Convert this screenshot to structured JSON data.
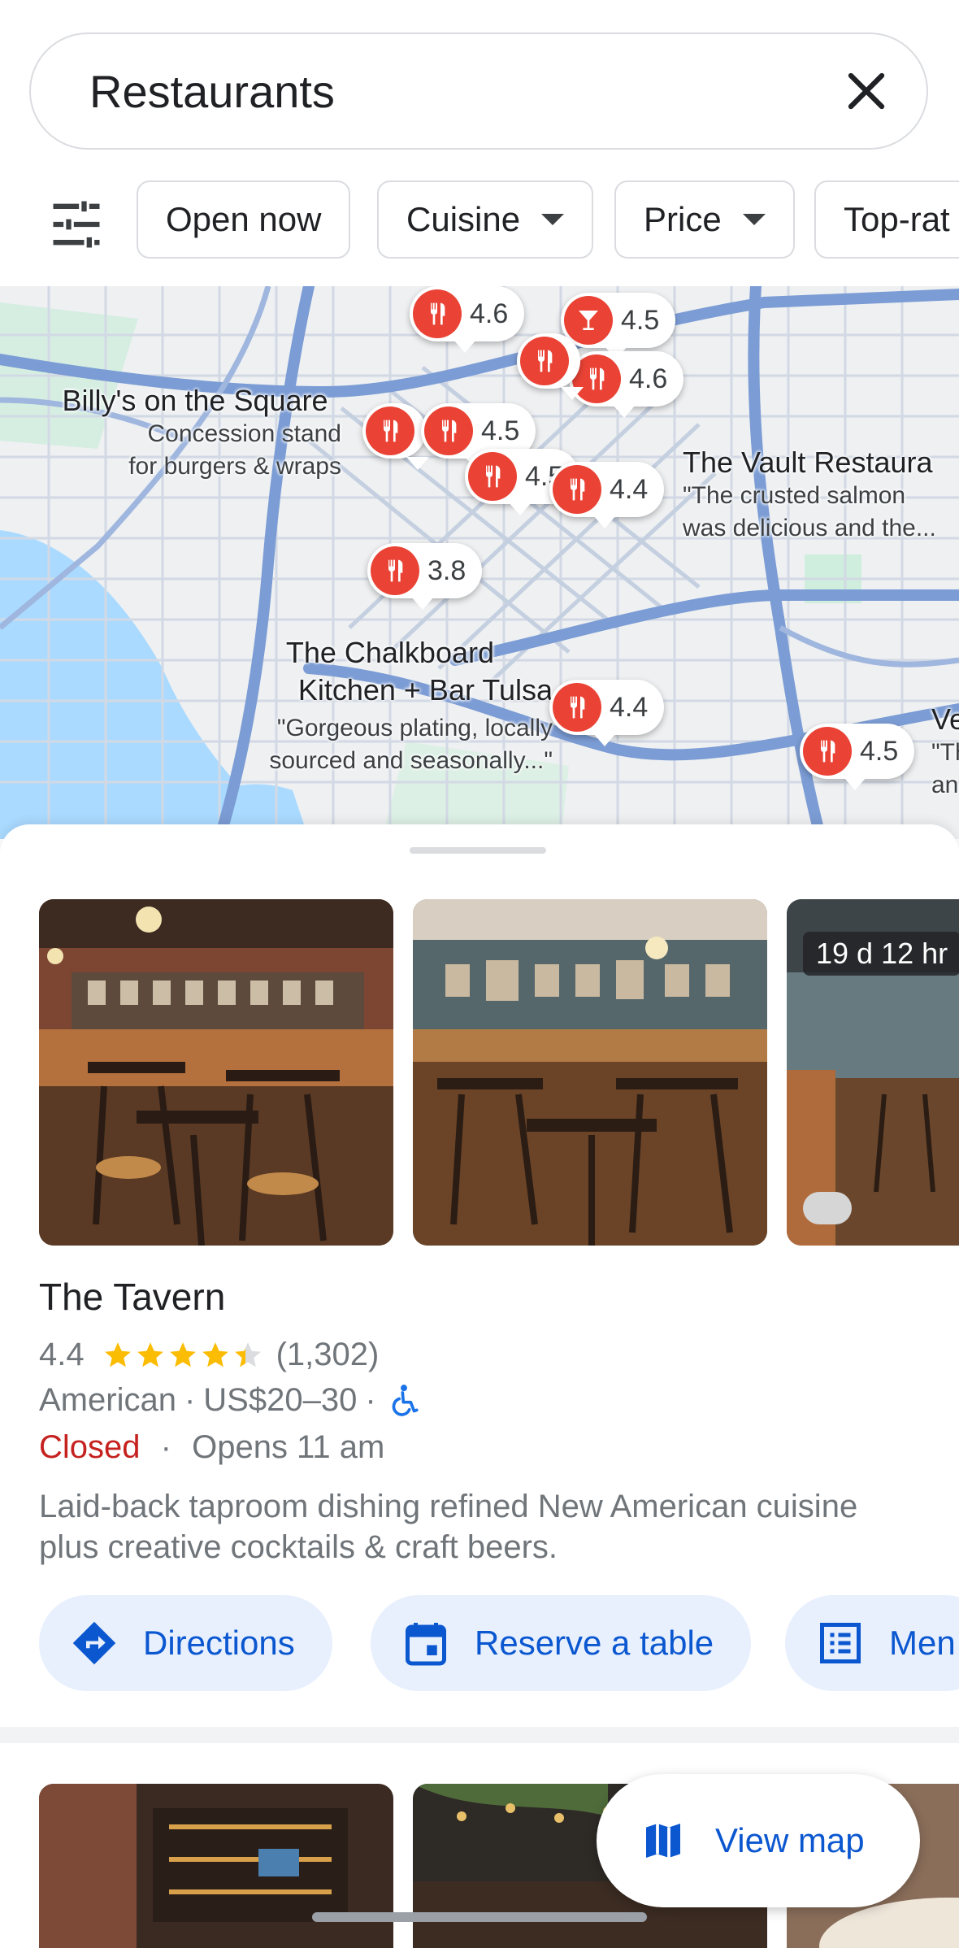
{
  "search": {
    "query": "Restaurants",
    "clear_icon": "close-icon"
  },
  "filters": {
    "icon": "tune-icon",
    "chips": [
      {
        "label": "Open now",
        "dropdown": false
      },
      {
        "label": "Cuisine",
        "dropdown": true
      },
      {
        "label": "Price",
        "dropdown": true
      },
      {
        "label": "Top-rat",
        "dropdown": false
      }
    ]
  },
  "map": {
    "pins": [
      {
        "rating": "4.6"
      },
      {
        "rating": "4.5"
      },
      {
        "rating": "4.6"
      },
      {
        "rating": "4.5"
      },
      {
        "rating": "4.5"
      },
      {
        "rating": "4.4"
      },
      {
        "rating": "3.8"
      },
      {
        "rating": "4.4"
      },
      {
        "rating": "4.5"
      }
    ],
    "labels": [
      {
        "name": "Billy's on the Square",
        "desc1": "Concession stand",
        "desc2": "for burgers & wraps"
      },
      {
        "name": "The Vault Restaura",
        "desc1": "\"The crusted salmon",
        "desc2": "was delicious and the..."
      },
      {
        "name": "The Chalkboard",
        "name2": "Kitchen + Bar Tulsa",
        "desc1": "\"Gorgeous plating, locally",
        "desc2": "sourced and seasonally...\""
      },
      {
        "name": "Ve",
        "desc1": "\"Th",
        "desc2": "an"
      }
    ],
    "colors": {
      "water": "#aadaff",
      "park": "#c8ebd4",
      "highway": "#7b9cd4",
      "road": "#c4cfe0"
    }
  },
  "place": {
    "photo_badge": "19 d 12 hr",
    "name": "The Tavern",
    "rating": "4.4",
    "stars": 4.4,
    "reviews": "(1,302)",
    "cuisine": "American",
    "price": "US$20–30",
    "accessible_icon": "wheelchair-icon",
    "status": "Closed",
    "opens": "Opens 11 am",
    "description": "Laid-back taproom dishing refined New American cuisine plus creative cocktails & craft beers.",
    "actions": [
      {
        "label": "Directions",
        "icon": "directions-icon"
      },
      {
        "label": "Reserve a table",
        "icon": "calendar-icon"
      },
      {
        "label": "Men",
        "icon": "menu-list-icon"
      }
    ]
  },
  "view_map": {
    "label": "View map",
    "icon": "map-icon"
  },
  "colors": {
    "accent": "#0b57d0",
    "chip_bg": "#e8f0fe",
    "closed": "#c5221f",
    "pin": "#ea4335",
    "star": "#fbbc04"
  }
}
